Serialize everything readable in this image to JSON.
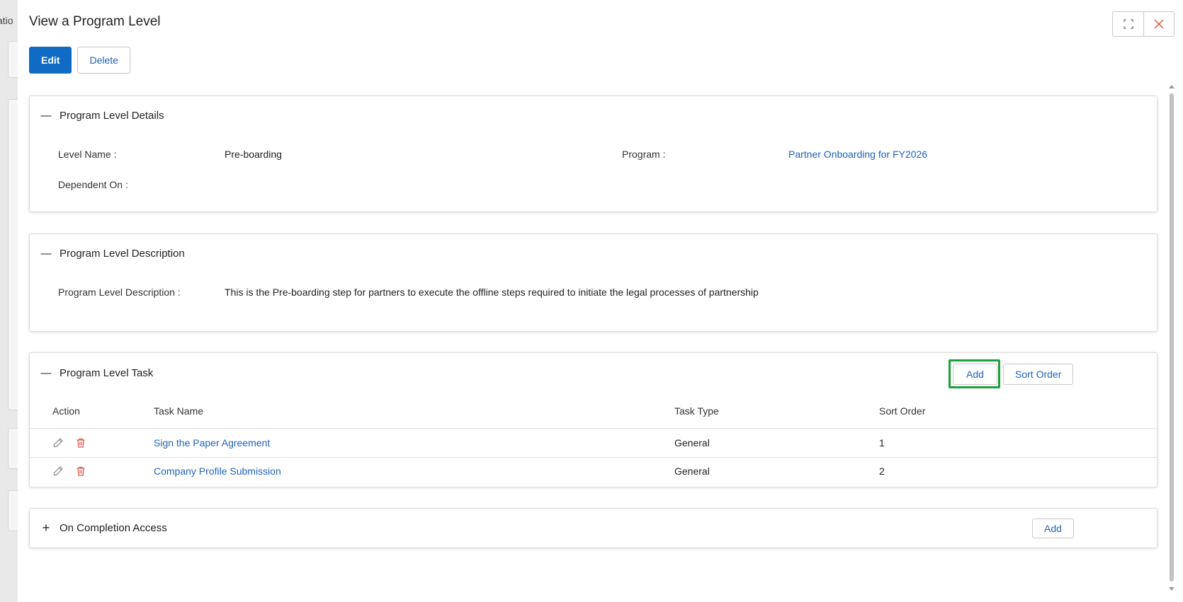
{
  "backdrop": {
    "partial_text": "atio"
  },
  "panel": {
    "title": "View a Program Level",
    "window_controls": {
      "expand_icon": "expand-icon",
      "close_icon": "close-icon"
    }
  },
  "toolbar": {
    "edit_label": "Edit",
    "delete_label": "Delete"
  },
  "details": {
    "title": "Program Level Details",
    "toggle": "—",
    "level_name_label": "Level Name :",
    "level_name_value": "Pre-boarding",
    "program_label": "Program :",
    "program_value": "Partner Onboarding for FY2026",
    "dependent_on_label": "Dependent On :"
  },
  "description": {
    "title": "Program Level Description",
    "toggle": "—",
    "label": "Program Level Description :",
    "value": "This is the Pre-boarding step for partners to execute the offline steps required to initiate the legal processes of partnership"
  },
  "tasks": {
    "title": "Program Level Task",
    "toggle": "—",
    "add_label": "Add",
    "sort_order_label": "Sort Order",
    "columns": [
      "Action",
      "Task Name",
      "Task Type",
      "Sort Order"
    ],
    "rows": [
      {
        "name": "Sign the Paper Agreement",
        "type": "General",
        "sort": "1"
      },
      {
        "name": "Company Profile Submission",
        "type": "General",
        "sort": "2"
      }
    ]
  },
  "completion": {
    "title": "On Completion Access",
    "toggle": "+",
    "add_label": "Add"
  },
  "colors": {
    "primary": "#0f6bc4",
    "link": "#1f63b8",
    "highlight": "#1aa13a",
    "delete": "#e0524a"
  }
}
